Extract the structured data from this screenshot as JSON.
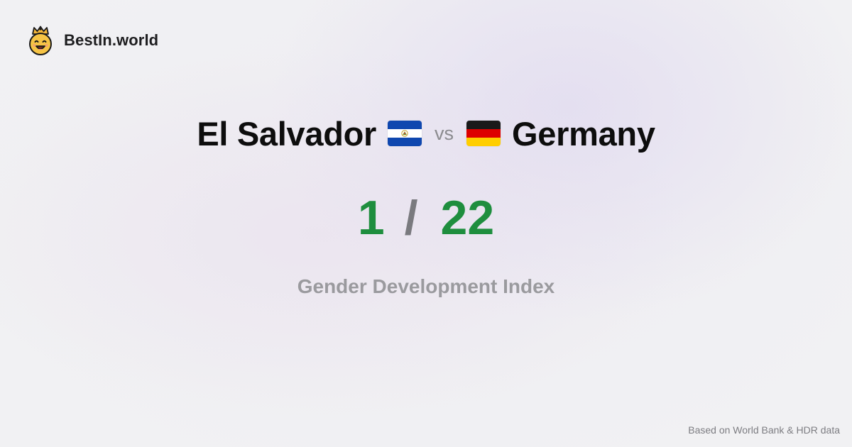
{
  "brand": {
    "name": "BestIn.world",
    "logo_icon": "crowned-smiley-icon"
  },
  "comparison": {
    "left": {
      "country": "El Salvador",
      "flag_icon": "el-salvador-flag-icon",
      "rank": "1"
    },
    "separator": "vs",
    "right": {
      "country": "Germany",
      "flag_icon": "germany-flag-icon",
      "rank": "22"
    },
    "rank_separator": "/"
  },
  "metric": {
    "title": "Gender Development Index"
  },
  "footer": {
    "source": "Based on World Bank & HDR data"
  },
  "colors": {
    "score": "#1e8e3e",
    "muted": "#9a9a9e",
    "text": "#0d0d0d",
    "germany_black": "#1a1a1a",
    "germany_red": "#dd0000",
    "germany_gold": "#ffce00",
    "el_salvador_blue": "#0f47af",
    "el_salvador_white": "#ffffff"
  }
}
